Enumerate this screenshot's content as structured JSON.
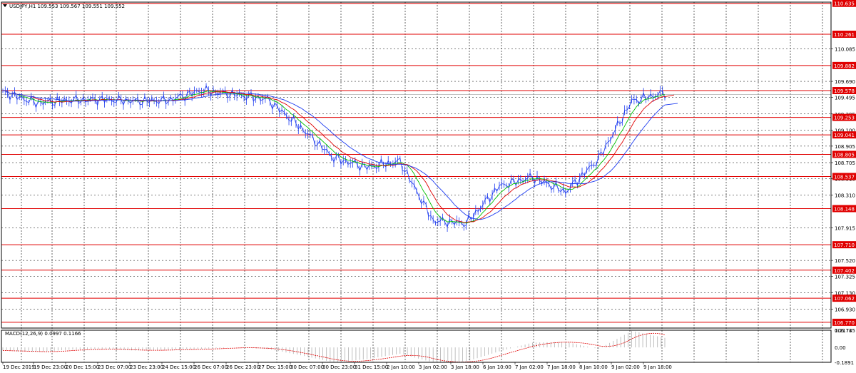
{
  "main_chart": {
    "title": "USDJPY,H1  109.553 109.567 109.551 109.552",
    "menu_icon": "triangle-down-icon",
    "y_ticks": [
      "110.085",
      "109.690",
      "109.495",
      "109.295",
      "109.100",
      "108.905",
      "108.705",
      "108.510",
      "108.310",
      "107.915",
      "107.520",
      "107.325",
      "107.130",
      "106.930"
    ],
    "levels": [
      {
        "value": "110.635",
        "color": "#e00000"
      },
      {
        "value": "110.261",
        "color": "#e00000"
      },
      {
        "value": "109.882",
        "color": "#e00000"
      },
      {
        "value": "109.578",
        "color": "#e00000"
      },
      {
        "value": "109.253",
        "color": "#e00000"
      },
      {
        "value": "109.041",
        "color": "#e00000"
      },
      {
        "value": "108.805",
        "color": "#e00000"
      },
      {
        "value": "108.537",
        "color": "#e00000"
      },
      {
        "value": "108.148",
        "color": "#e00000"
      },
      {
        "value": "107.710",
        "color": "#e00000"
      },
      {
        "value": "107.402",
        "color": "#e00000"
      },
      {
        "value": "107.062",
        "color": "#e00000"
      },
      {
        "value": "106.770",
        "color": "#e00000"
      }
    ],
    "bid_line_color": "#a0a0a0",
    "price_series_color": "#1e3cf0",
    "moving_averages": [
      {
        "color": "#00c000"
      },
      {
        "color": "#e00000"
      },
      {
        "color": "#1e3cf0"
      }
    ]
  },
  "macd_panel": {
    "title": "MACD(12,26,9) 0.0997 0.1166",
    "y_ticks": [
      "0.2174",
      "0.00",
      "-0.1891"
    ],
    "top_label": "106.735",
    "histogram_color": "#b0b0b0",
    "signal_color": "#e00000"
  },
  "time_axis": {
    "labels": [
      "19 Dec 2019",
      "19 Dec 23:00",
      "20 Dec 15:00",
      "23 Dec 07:00",
      "23 Dec 23:00",
      "24 Dec 15:00",
      "26 Dec 07:00",
      "26 Dec 23:00",
      "27 Dec 15:00",
      "30 Dec 07:00",
      "30 Dec 23:00",
      "31 Dec 15:00",
      "2 Jan 10:00",
      "3 Jan 02:00",
      "3 Jan 18:00",
      "6 Jan 10:00",
      "7 Jan 02:00",
      "7 Jan 18:00",
      "8 Jan 10:00",
      "9 Jan 02:00",
      "9 Jan 18:00"
    ]
  },
  "chart_data": {
    "type": "line",
    "title": "USDJPY,H1",
    "x": [
      "19 Dec 2019",
      "19 Dec 23:00",
      "20 Dec 15:00",
      "23 Dec 07:00",
      "23 Dec 23:00",
      "24 Dec 15:00",
      "26 Dec 07:00",
      "26 Dec 23:00",
      "27 Dec 15:00",
      "30 Dec 07:00",
      "30 Dec 23:00",
      "31 Dec 15:00",
      "2 Jan 10:00",
      "3 Jan 02:00",
      "3 Jan 18:00",
      "6 Jan 10:00",
      "7 Jan 02:00",
      "7 Jan 18:00",
      "8 Jan 10:00",
      "9 Jan 02:00",
      "9 Jan 18:00"
    ],
    "series": [
      {
        "values": [
          109.56,
          109.43,
          109.46,
          109.47,
          109.45,
          109.46,
          109.58,
          109.53,
          109.47,
          109.13,
          108.76,
          108.65,
          108.72,
          108.0,
          107.97,
          108.42,
          108.53,
          108.35,
          108.75,
          109.45,
          109.55
        ]
      }
    ],
    "ylim": [
      106.7,
      110.65
    ],
    "macd": {
      "x_count": 21,
      "values": [
        -0.04,
        -0.06,
        -0.03,
        -0.02,
        -0.04,
        -0.03,
        -0.02,
        0.0,
        -0.02,
        -0.1,
        -0.19,
        -0.15,
        -0.08,
        -0.19,
        -0.18,
        -0.05,
        0.06,
        0.07,
        -0.02,
        0.21,
        0.12
      ]
    },
    "macd_ylim": [
      -0.1891,
      0.2174
    ],
    "grid": true
  }
}
